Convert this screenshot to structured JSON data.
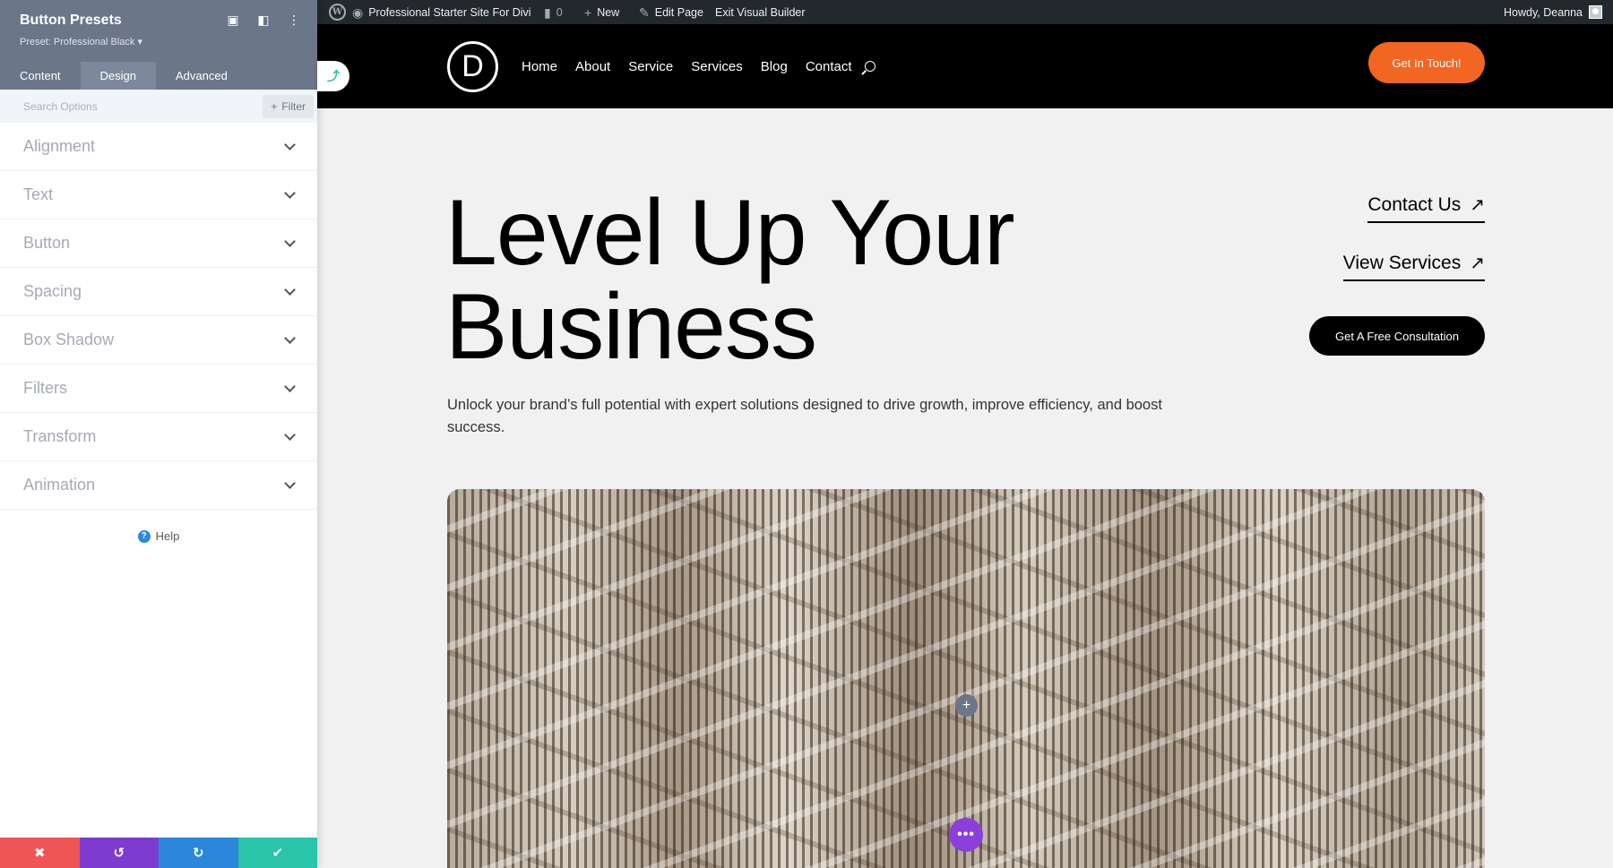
{
  "adminbar": {
    "site_name": "Professional Starter Site For Divi",
    "comments_count": "0",
    "new_label": "New",
    "edit_label": "Edit Page",
    "exit_label": "Exit Visual Builder",
    "howdy": "Howdy, Deanna"
  },
  "panel": {
    "title": "Button Presets",
    "preset": "Preset: Professional Black ▾",
    "tabs": [
      "Content",
      "Design",
      "Advanced"
    ],
    "active_tab": "Design",
    "search_placeholder": "Search Options",
    "filter_label": "Filter",
    "groups": [
      "Alignment",
      "Text",
      "Button",
      "Spacing",
      "Box Shadow",
      "Filters",
      "Transform",
      "Animation"
    ],
    "help_label": "Help",
    "footer_colors": {
      "discard": "#ef5555",
      "undo": "#7e3bd0",
      "redo": "#2b87da",
      "save": "#29c4a9"
    }
  },
  "site": {
    "logo_letter": "D",
    "nav": [
      "Home",
      "About",
      "Service",
      "Services",
      "Blog",
      "Contact"
    ],
    "cta_label": "Get In Touch!",
    "accent": "#f26522"
  },
  "hero": {
    "title_line1": "Level Up Your",
    "title_line2": "Business",
    "subtitle": "Unlock your brand’s full potential with expert solutions designed to drive growth, improve efficiency, and boost success.",
    "link1": "Contact Us",
    "link2": "View Services",
    "button": "Get A Free Consultation"
  }
}
